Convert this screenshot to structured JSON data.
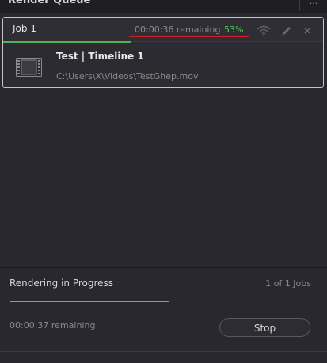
{
  "panel": {
    "title": "Render Queue",
    "menu_icon": "ellipsis-icon"
  },
  "job": {
    "name": "Job 1",
    "remaining": "00:00:36 remaining",
    "percent_text": "53%",
    "progress_fraction": 0.53,
    "icons": [
      "wifi-signal-icon",
      "pencil-icon",
      "close-icon"
    ],
    "clip_title": "Test | Timeline 1",
    "clip_path": "C:\\Users\\X\\Videos\\TestGhep.mov",
    "thumbnail_icon": "film-strip-icon"
  },
  "status": {
    "title": "Rendering in Progress",
    "count": "1 of 1 Jobs",
    "progress_fraction": 0.5,
    "remaining": "00:00:37 remaining",
    "stop_label": "Stop"
  },
  "colors": {
    "accent_green": "#53c25a",
    "highlight_red": "#d21e2a",
    "background": "#28282e"
  }
}
